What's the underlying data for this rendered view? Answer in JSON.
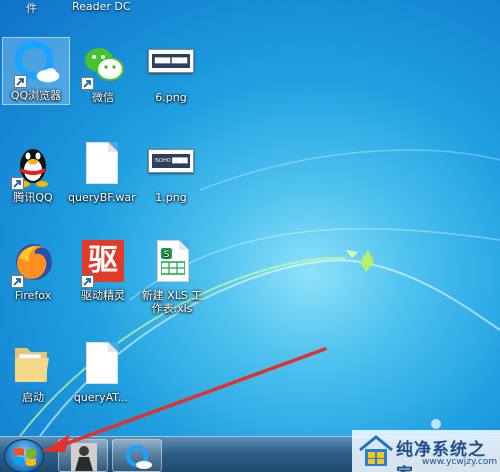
{
  "desktop": {
    "top_row": [
      {
        "label": "件"
      },
      {
        "label": "Reader DC"
      }
    ],
    "icons": [
      {
        "id": "qq-browser",
        "label": "QQ浏览器",
        "icon": "qq-browser-icon",
        "shortcut": true,
        "selected": true
      },
      {
        "id": "wechat",
        "label": "微信",
        "icon": "wechat-icon",
        "shortcut": true
      },
      {
        "id": "6png",
        "label": "6.png",
        "icon": "image-thumbnail-icon",
        "thumb_text": "████ ████"
      },
      {
        "id": "tencent-qq",
        "label": "腾讯QQ",
        "icon": "qq-penguin-icon",
        "shortcut": true
      },
      {
        "id": "querybf",
        "label": "queryBF.war",
        "icon": "file-icon"
      },
      {
        "id": "1png",
        "label": "1.png",
        "icon": "image-thumbnail-icon",
        "thumb_text": "ISOHO ████"
      },
      {
        "id": "firefox",
        "label": "Firefox",
        "icon": "firefox-icon",
        "shortcut": true
      },
      {
        "id": "qudong",
        "label": "驱动精灵",
        "icon": "driver-genius-icon",
        "shortcut": true,
        "glyph": "驱"
      },
      {
        "id": "xls",
        "label": "新建 XLS 工\n作表.xls",
        "icon": "spreadsheet-icon"
      },
      {
        "id": "qidong",
        "label": "启动",
        "icon": "folder-icon"
      },
      {
        "id": "queryat",
        "label": "queryAT...",
        "icon": "file-icon"
      }
    ]
  },
  "taskbar": {
    "start_label": "Start",
    "buttons": [
      {
        "name": "taskbar-app-avatar",
        "icon": "person-photo-icon"
      },
      {
        "name": "taskbar-app-qq-browser",
        "icon": "qq-browser-icon"
      }
    ]
  },
  "watermark": {
    "title": "纯净系统之家",
    "url": "www.ycwjzy.com"
  },
  "colors": {
    "wallpaper": "#1f9fe0",
    "taskbar": "#2e5f87",
    "arrow": "#e0322c"
  }
}
